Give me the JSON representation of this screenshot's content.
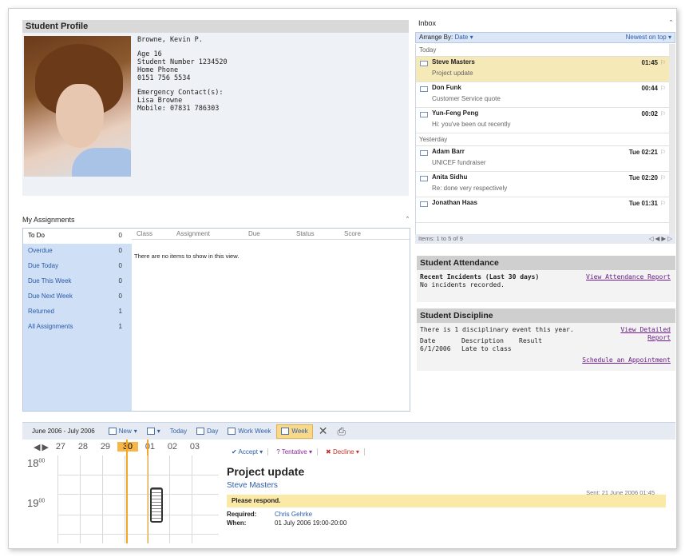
{
  "profile": {
    "title": "Student Profile",
    "name": "Browne, Kevin P.",
    "age": "Age 16",
    "student_number": "Student Number 1234520",
    "home_phone_label": "Home Phone",
    "home_phone": "0151 756 5534",
    "emergency_label": "Emergency Contact(s):",
    "emergency_name": "Lisa Browne",
    "emergency_mobile": "Mobile: 07831 786303"
  },
  "inbox": {
    "title": "Inbox",
    "arrange_by": "Arrange By:",
    "arrange_value": "Date",
    "sort": "Newest on top",
    "groups": [
      {
        "label": "Today",
        "items": [
          {
            "from": "Steve Masters",
            "subject": "Project update",
            "time": "01:45",
            "selected": true
          },
          {
            "from": "Don Funk",
            "subject": "Customer Service quote",
            "time": "00:44",
            "selected": false
          },
          {
            "from": "Yun-Feng Peng",
            "subject": "Hi: you've been out recently",
            "time": "00:02",
            "selected": false
          }
        ]
      },
      {
        "label": "Yesterday",
        "items": [
          {
            "from": "Adam Barr",
            "subject": "UNICEF fundraiser",
            "time": "Tue 02:21",
            "selected": false
          },
          {
            "from": "Anita Sidhu",
            "subject": "Re: done very respectively",
            "time": "Tue 02:20",
            "selected": false
          },
          {
            "from": "Jonathan Haas",
            "subject": "",
            "time": "Tue 01:31",
            "selected": false
          }
        ]
      }
    ],
    "footer_items": "Items:",
    "footer_range": "1 to 5 of 9"
  },
  "attendance": {
    "title": "Student Attendance",
    "recent_label": "Recent Incidents (Last 30 days)",
    "link": "View Attendance Report",
    "message": "No incidents recorded."
  },
  "discipline": {
    "title": "Student Discipline",
    "summary": "There is 1 disciplinary event this year.",
    "link_detailed": "View Detailed Report",
    "col_date": "Date",
    "col_description": "Description",
    "col_result": "Result",
    "row_date": "6/1/2006",
    "row_description": "Late to class",
    "link_schedule": "Schedule an Appointment"
  },
  "assignments": {
    "title": "My Assignments",
    "nav": [
      {
        "label": "To Do",
        "count": "0",
        "selected": true
      },
      {
        "label": "Overdue",
        "count": "0",
        "selected": false
      },
      {
        "label": "Due Today",
        "count": "0",
        "selected": false
      },
      {
        "label": "Due This Week",
        "count": "0",
        "selected": false
      },
      {
        "label": "Due Next Week",
        "count": "0",
        "selected": false
      },
      {
        "label": "Returned",
        "count": "1",
        "selected": false
      },
      {
        "label": "All Assignments",
        "count": "1",
        "selected": false
      }
    ],
    "columns": [
      "Class",
      "Assignment",
      "Due",
      "Status",
      "Score"
    ],
    "empty": "There are no items to show in this view."
  },
  "calendar": {
    "range": "June 2006 - July 2006",
    "buttons": [
      "New",
      "Today",
      "Day",
      "Work Week",
      "Week"
    ],
    "days": [
      "27",
      "28",
      "29",
      "30",
      "01",
      "02",
      "03"
    ],
    "hours": [
      "18",
      "19"
    ]
  },
  "reading": {
    "accept": "Accept",
    "tentative": "Tentative",
    "decline": "Decline",
    "subject": "Project update",
    "sender": "Steve Masters",
    "sent": "Sent: 21 June 2006 01:45",
    "notice": "Please respond.",
    "required_label": "Required:",
    "required_value": "Chris Gehrke",
    "when_label": "When:",
    "when_value": "01 July 2006 19:00-20:00"
  }
}
